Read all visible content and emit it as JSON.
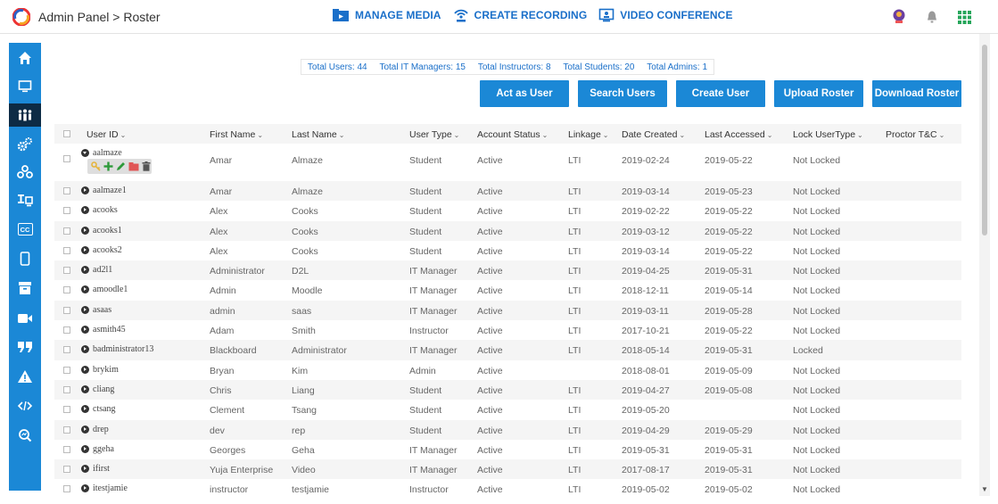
{
  "header": {
    "breadcrumb": "Admin Panel > Roster",
    "nav": [
      {
        "label": "MANAGE MEDIA",
        "icon": "media-folder-icon"
      },
      {
        "label": "CREATE RECORDING",
        "icon": "broadcast-icon"
      },
      {
        "label": "VIDEO CONFERENCE",
        "icon": "conference-screen-icon"
      }
    ],
    "right_icons": [
      "user-avatar-icon",
      "bell-icon",
      "apps-grid-icon"
    ]
  },
  "sidebar": {
    "items": [
      "home-icon",
      "monitor-icon",
      "users-icon",
      "settings-gears-icon",
      "group-icon",
      "display-icon",
      "closed-captions-icon",
      "mobile-icon",
      "archive-icon",
      "video-camera-icon",
      "quote-icon",
      "alert-icon",
      "code-icon",
      "search-analytics-icon"
    ],
    "active_index": 2,
    "captions_label": "CC"
  },
  "stats": {
    "users": "Total Users: 44",
    "it_managers": "Total IT Managers: 15",
    "instructors": "Total Instructors: 8",
    "students": "Total Students: 20",
    "admins": "Total Admins: 1"
  },
  "actions": {
    "act_as_user": "Act as User",
    "search_users": "Search Users",
    "create_user": "Create User",
    "upload_roster": "Upload Roster",
    "download_roster": "Download Roster"
  },
  "table": {
    "columns": [
      "User ID",
      "First Name",
      "Last Name",
      "User Type",
      "Account Status",
      "Linkage",
      "Date Created",
      "Last Accessed",
      "Lock UserType",
      "Proctor T&C"
    ],
    "rows": [
      [
        "aalmaze",
        "Amar",
        "Almaze",
        "Student",
        "Active",
        "LTI",
        "2019-02-24",
        "2019-05-22",
        "Not Locked"
      ],
      [
        "aalmaze1",
        "Amar",
        "Almaze",
        "Student",
        "Active",
        "LTI",
        "2019-03-14",
        "2019-05-23",
        "Not Locked"
      ],
      [
        "acooks",
        "Alex",
        "Cooks",
        "Student",
        "Active",
        "LTI",
        "2019-02-22",
        "2019-05-22",
        "Not Locked"
      ],
      [
        "acooks1",
        "Alex",
        "Cooks",
        "Student",
        "Active",
        "LTI",
        "2019-03-12",
        "2019-05-22",
        "Not Locked"
      ],
      [
        "acooks2",
        "Alex",
        "Cooks",
        "Student",
        "Active",
        "LTI",
        "2019-03-14",
        "2019-05-22",
        "Not Locked"
      ],
      [
        "ad2l1",
        "Administrator",
        "D2L",
        "IT Manager",
        "Active",
        "LTI",
        "2019-04-25",
        "2019-05-31",
        "Not Locked"
      ],
      [
        "amoodle1",
        "Admin",
        "Moodle",
        "IT Manager",
        "Active",
        "LTI",
        "2018-12-11",
        "2019-05-14",
        "Not Locked"
      ],
      [
        "asaas",
        "admin",
        "saas",
        "IT Manager",
        "Active",
        "LTI",
        "2019-03-11",
        "2019-05-28",
        "Not Locked"
      ],
      [
        "asmith45",
        "Adam",
        "Smith",
        "Instructor",
        "Active",
        "LTI",
        "2017-10-21",
        "2019-05-22",
        "Not Locked"
      ],
      [
        "badministrator13",
        "Blackboard",
        "Administrator",
        "IT Manager",
        "Active",
        "LTI",
        "2018-05-14",
        "2019-05-31",
        "Locked"
      ],
      [
        "brykim",
        "Bryan",
        "Kim",
        "Admin",
        "Active",
        "",
        "2018-08-01",
        "2019-05-09",
        "Not Locked"
      ],
      [
        "cliang",
        "Chris",
        "Liang",
        "Student",
        "Active",
        "LTI",
        "2019-04-27",
        "2019-05-08",
        "Not Locked"
      ],
      [
        "ctsang",
        "Clement",
        "Tsang",
        "Student",
        "Active",
        "LTI",
        "2019-05-20",
        "",
        "Not Locked"
      ],
      [
        "drep",
        "dev",
        "rep",
        "Student",
        "Active",
        "LTI",
        "2019-04-29",
        "2019-05-29",
        "Not Locked"
      ],
      [
        "ggeha",
        "Georges",
        "Geha",
        "IT Manager",
        "Active",
        "LTI",
        "2019-05-31",
        "2019-05-31",
        "Not Locked"
      ],
      [
        "ifirst",
        "Yuja Enterprise",
        "Video",
        "IT Manager",
        "Active",
        "LTI",
        "2017-08-17",
        "2019-05-31",
        "Not Locked"
      ],
      [
        "itestjamie",
        "instructor",
        "testjamie",
        "Instructor",
        "Active",
        "LTI",
        "2019-05-02",
        "2019-05-02",
        "Not Locked"
      ]
    ],
    "row_tools": [
      "key-icon",
      "plus-icon",
      "pencil-icon",
      "folder-icon",
      "trash-icon"
    ]
  },
  "colors": {
    "brand": "#1b88d6",
    "sidebar_active": "#0d2b45",
    "tool_green": "#2e9a3a",
    "tool_red": "#e05555",
    "tool_yellow": "#e5b43c"
  }
}
